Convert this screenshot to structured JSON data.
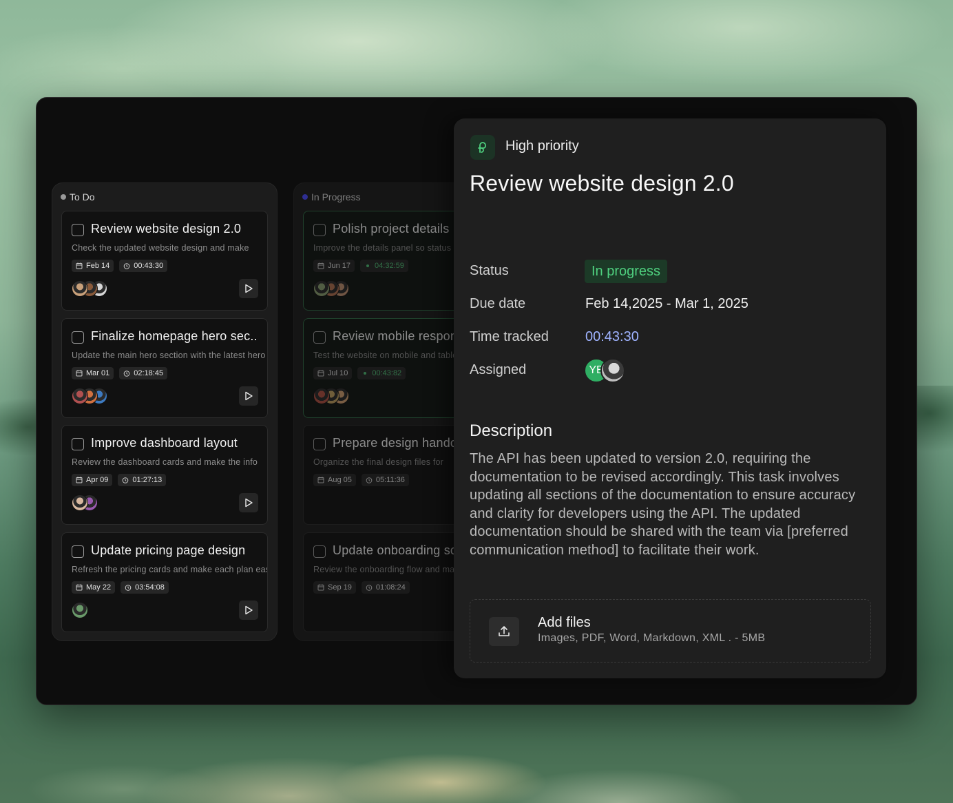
{
  "board": {
    "columns": [
      {
        "name": "To Do",
        "dot_color": "#9a9a9a",
        "cards": [
          {
            "title": "Review website design 2.0",
            "desc": "Check the updated website design and make",
            "date": "Feb 14",
            "time": "00:43:30",
            "avatars": [
              "#c8a07a",
              "#8a5a3a",
              "#d6d6d6"
            ]
          },
          {
            "title": "Finalize homepage hero sec..",
            "desc": "Update the main hero section with the latest hero",
            "date": "Mar 01",
            "time": "02:18:45",
            "avatars": [
              "#b05050",
              "#d07040",
              "#3d7ac0"
            ]
          },
          {
            "title": "Improve dashboard layout",
            "desc": "Review the dashboard cards and make the info",
            "date": "Apr 09",
            "time": "01:27:13",
            "avatars": [
              "#d8b8a0",
              "#9a5ab0"
            ]
          },
          {
            "title": "Update pricing page design",
            "desc": "Refresh the pricing cards and make each plan easy",
            "date": "May 22",
            "time": "03:54:08",
            "avatars": [
              "#6a9a6a"
            ]
          }
        ]
      },
      {
        "name": "In Progress",
        "dot_color": "#4a4aff",
        "cards": [
          {
            "title": "Polish project details",
            "desc": "Improve the details panel so status",
            "date": "Jun 17",
            "time": "04:32:59",
            "avatars": [
              "#8aa070",
              "#b07050",
              "#c09070"
            ]
          },
          {
            "title": "Review mobile responsive",
            "desc": "Test the website on mobile and tablet",
            "date": "Jul 10",
            "time": "00:43:82",
            "avatars": [
              "#b05040",
              "#c0a060",
              "#d0a070"
            ]
          },
          {
            "title": "Prepare design handoff",
            "desc": "Organize the final design files for",
            "date": "Aug 05",
            "time": "05:11:36",
            "avatars": []
          },
          {
            "title": "Update onboarding screens",
            "desc": "Review the onboarding flow and make",
            "date": "Sep 19",
            "time": "01:08:24",
            "avatars": []
          }
        ]
      }
    ]
  },
  "details": {
    "priority": "High priority",
    "title": "Review website design 2.0",
    "labels": {
      "status": "Status",
      "due_date": "Due date",
      "time_tracked": "Time tracked",
      "assigned": "Assigned"
    },
    "status": "In progress",
    "due_date": "Feb 14,2025 - Mar 1, 2025",
    "time_tracked": "00:43:30",
    "assignee_initials": "YB",
    "description_heading": "Description",
    "description": "The API has been updated to version 2.0, requiring the documentation to be revised accordingly.  This task involves updating all sections of the documentation to ensure accuracy and clarity for developers using the API.  The updated documentation should be shared with the team via [preferred communication method] to facilitate their work.",
    "add_files_title": "Add files",
    "add_files_sub": "Images, PDF, Word, Markdown, XML . - 5MB"
  },
  "colors": {
    "accent_green": "#4fd07f",
    "time_blue": "#9fb3ff"
  }
}
